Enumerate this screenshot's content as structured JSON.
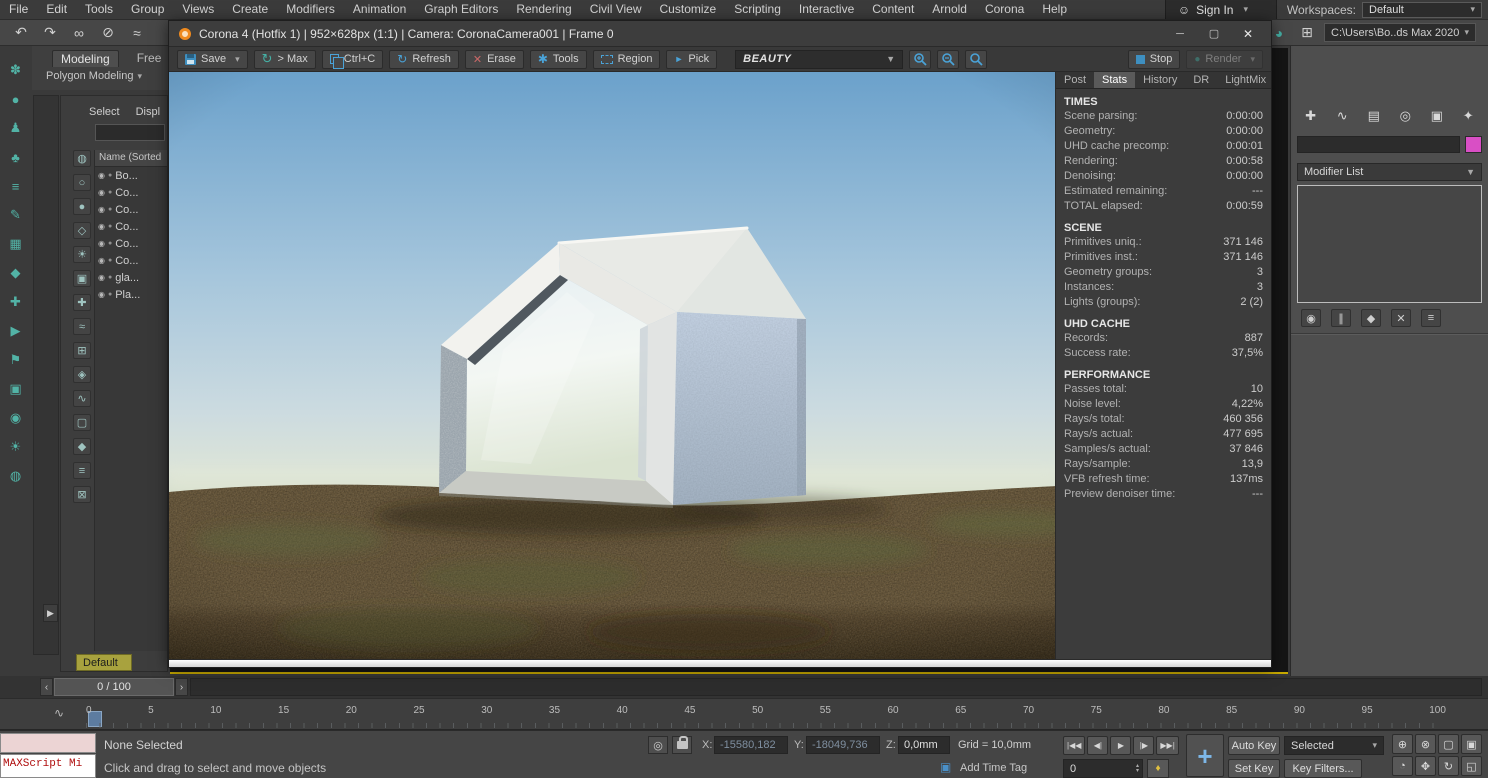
{
  "menubar": {
    "items": [
      "File",
      "Edit",
      "Tools",
      "Group",
      "Views",
      "Create",
      "Modifiers",
      "Animation",
      "Graph Editors",
      "Rendering",
      "Civil View",
      "Customize",
      "Scripting",
      "Interactive",
      "Content",
      "Arnold",
      "Corona",
      "Help"
    ],
    "sign_in_label": "Sign In",
    "workspaces_label": "Workspaces:",
    "workspace_value": "Default"
  },
  "top_toolbar": {
    "project_path": "C:\\Users\\Bo..ds Max 2020",
    "icons": [
      {
        "name": "undo-icon",
        "glyph": "↶"
      },
      {
        "name": "redo-icon",
        "glyph": "↷"
      },
      {
        "name": "select-and-link-icon",
        "glyph": "∞"
      },
      {
        "name": "unlink-selection-icon",
        "glyph": "⊘"
      },
      {
        "name": "bind-to-space-warp-icon",
        "glyph": "≈"
      }
    ]
  },
  "ribbon": {
    "tab_modeling": "Modeling",
    "tab_freeform": "Free",
    "panel_label": "Polygon Modeling"
  },
  "left_toolbar": {
    "icons": [
      {
        "name": "flower-icon",
        "glyph": "✽"
      },
      {
        "name": "sphere-icon",
        "glyph": "●"
      },
      {
        "name": "person-icon",
        "glyph": "♟"
      },
      {
        "name": "tree-icon",
        "glyph": "♣"
      },
      {
        "name": "layers-icon",
        "glyph": "≡"
      },
      {
        "name": "pencil-icon",
        "glyph": "✎"
      },
      {
        "name": "grid-icon",
        "glyph": "▦"
      },
      {
        "name": "diamond-icon",
        "glyph": "◆"
      },
      {
        "name": "plus-icon",
        "glyph": "✚"
      },
      {
        "name": "play-icon",
        "glyph": "▶"
      },
      {
        "name": "flag-icon",
        "glyph": "⚑"
      },
      {
        "name": "box-icon",
        "glyph": "▣"
      },
      {
        "name": "target-icon",
        "glyph": "◉"
      },
      {
        "name": "sun-icon",
        "glyph": "☀"
      },
      {
        "name": "eye-icon",
        "glyph": "◍"
      }
    ]
  },
  "scene_explorer": {
    "menu_select": "Select",
    "menu_display": "Displ",
    "column_header": "Name (Sorted",
    "bottom_label": "Default",
    "filter_icons": [
      {
        "name": "display-all-icon",
        "glyph": "◍"
      },
      {
        "name": "display-none-icon",
        "glyph": "○"
      },
      {
        "name": "display-geometry-icon",
        "glyph": "●"
      },
      {
        "name": "display-shapes-icon",
        "glyph": "◇"
      },
      {
        "name": "display-lights-icon",
        "glyph": "☀"
      },
      {
        "name": "display-cameras-icon",
        "glyph": "▣"
      },
      {
        "name": "display-helpers-icon",
        "glyph": "✚"
      },
      {
        "name": "display-spacewarps-icon",
        "glyph": "≈"
      },
      {
        "name": "display-groups-icon",
        "glyph": "⊞"
      },
      {
        "name": "display-xrefs-icon",
        "glyph": "◈"
      },
      {
        "name": "display-bones-icon",
        "glyph": "∿"
      },
      {
        "name": "display-containers-icon",
        "glyph": "▢"
      },
      {
        "name": "display-materials-icon",
        "glyph": "◆"
      },
      {
        "name": "sort-icon",
        "glyph": "≡"
      },
      {
        "name": "pin-explorer-icon",
        "glyph": "⊠"
      }
    ],
    "rows": [
      {
        "label": "Bo..."
      },
      {
        "label": "Co..."
      },
      {
        "label": "Co..."
      },
      {
        "label": "Co..."
      },
      {
        "label": "Co..."
      },
      {
        "label": "Co..."
      },
      {
        "label": "gla..."
      },
      {
        "label": "Pla..."
      }
    ]
  },
  "vfb": {
    "title": "Corona 4 (Hotfix 1) | 952×628px (1:1) | Camera: CoronaCamera001 | Frame 0",
    "buttons": {
      "save": "Save",
      "to_max": "> Max",
      "copy": "Ctrl+C",
      "refresh": "Refresh",
      "erase": "Erase",
      "tools": "Tools",
      "region": "Region",
      "pick": "Pick",
      "render_element": "BEAUTY",
      "stop": "Stop",
      "render": "Render"
    },
    "tabs": [
      "Post",
      "Stats",
      "History",
      "DR",
      "LightMix"
    ],
    "active_tab": "Stats",
    "stats": {
      "times_title": "TIMES",
      "times": [
        {
          "label": "Scene parsing:",
          "value": "0:00:00"
        },
        {
          "label": "Geometry:",
          "value": "0:00:00"
        },
        {
          "label": "UHD cache precomp:",
          "value": "0:00:01"
        },
        {
          "label": "Rendering:",
          "value": "0:00:58"
        },
        {
          "label": "Denoising:",
          "value": "0:00:00"
        },
        {
          "label": "Estimated remaining:",
          "value": "---"
        },
        {
          "label": "TOTAL elapsed:",
          "value": "0:00:59"
        }
      ],
      "scene_title": "SCENE",
      "scene": [
        {
          "label": "Primitives uniq.:",
          "value": "371 146"
        },
        {
          "label": "Primitives inst.:",
          "value": "371 146"
        },
        {
          "label": "Geometry groups:",
          "value": "3"
        },
        {
          "label": "Instances:",
          "value": "3"
        },
        {
          "label": "Lights (groups):",
          "value": "2 (2)"
        }
      ],
      "uhd_title": "UHD CACHE",
      "uhd": [
        {
          "label": "Records:",
          "value": "887"
        },
        {
          "label": "Success rate:",
          "value": "37,5%"
        }
      ],
      "performance_title": "PERFORMANCE",
      "performance": [
        {
          "label": "Passes total:",
          "value": "10"
        },
        {
          "label": "Noise level:",
          "value": "4,22%"
        },
        {
          "label": "Rays/s total:",
          "value": "460 356"
        },
        {
          "label": "Rays/s actual:",
          "value": "477 695"
        },
        {
          "label": "Samples/s actual:",
          "value": "37 846"
        },
        {
          "label": "Rays/sample:",
          "value": "13,9"
        },
        {
          "label": "VFB refresh time:",
          "value": "137ms"
        },
        {
          "label": "Preview denoiser time:",
          "value": "---"
        }
      ]
    }
  },
  "timeline": {
    "frame_display": "0 / 100",
    "ticks": [
      "0",
      "5",
      "10",
      "15",
      "20",
      "25",
      "30",
      "35",
      "40",
      "45",
      "50",
      "55",
      "60",
      "65",
      "70",
      "75",
      "80",
      "85",
      "90",
      "95",
      "100"
    ]
  },
  "status_bar": {
    "maxscript_label": "MAXScript Mi",
    "selection_status": "None Selected",
    "prompt": "Click and drag to select and move objects",
    "x_label": "X:",
    "x_value": "-15580,182",
    "y_label": "Y:",
    "y_value": "-18049,736",
    "z_label": "Z:",
    "z_value": "0,0mm",
    "grid_label": "Grid = 10,0mm",
    "add_time_tag": "Add Time Tag",
    "frame_field": "0",
    "auto_key": "Auto Key",
    "set_key": "Set Key",
    "selection_set": "Selected",
    "key_filters": "Key Filters...",
    "playback": [
      {
        "name": "go-to-start-button",
        "glyph": "|◀◀"
      },
      {
        "name": "previous-frame-button",
        "glyph": "◀|"
      },
      {
        "name": "play-button",
        "glyph": "▶"
      },
      {
        "name": "next-frame-button",
        "glyph": "|▶"
      },
      {
        "name": "go-to-end-button",
        "glyph": "▶▶|"
      }
    ],
    "nav_icons": [
      {
        "name": "zoom-icon",
        "glyph": "⊕"
      },
      {
        "name": "zoom-all-icon",
        "glyph": "⊗"
      },
      {
        "name": "zoom-extents-icon",
        "glyph": "▢"
      },
      {
        "name": "zoom-extents-all-icon",
        "glyph": "▣"
      },
      {
        "name": "field-of-view-icon",
        "glyph": "◔"
      },
      {
        "name": "pan-view-icon",
        "glyph": "✥"
      },
      {
        "name": "orbit-icon",
        "glyph": "↻"
      },
      {
        "name": "maximize-viewport-icon",
        "glyph": "◱"
      }
    ]
  },
  "command_panel": {
    "modifier_list_label": "Modifier List",
    "tabs": [
      {
        "name": "create-tab-icon",
        "glyph": "✚"
      },
      {
        "name": "modify-tab-icon",
        "glyph": "∿"
      },
      {
        "name": "hierarchy-tab-icon",
        "glyph": "▤"
      },
      {
        "name": "motion-tab-icon",
        "glyph": "◎"
      },
      {
        "name": "display-tab-icon",
        "glyph": "▣"
      },
      {
        "name": "utilities-tab-icon",
        "glyph": "✦"
      }
    ],
    "stack_icons": [
      {
        "name": "pin-stack-icon",
        "glyph": "◉"
      },
      {
        "name": "show-end-result-icon",
        "glyph": "∥"
      },
      {
        "name": "make-unique-icon",
        "glyph": "◆"
      },
      {
        "name": "remove-modifier-icon",
        "glyph": "✕"
      },
      {
        "name": "configure-modifier-sets-icon",
        "glyph": "≡"
      }
    ]
  },
  "colors": {
    "corona_orange": "#ef8a1e",
    "active_viewport_border": "#c9ab00",
    "object_color_swatch": "#d94fc5",
    "icon_teal": "#45b0a5",
    "icon_blue": "#4aa3d8"
  }
}
